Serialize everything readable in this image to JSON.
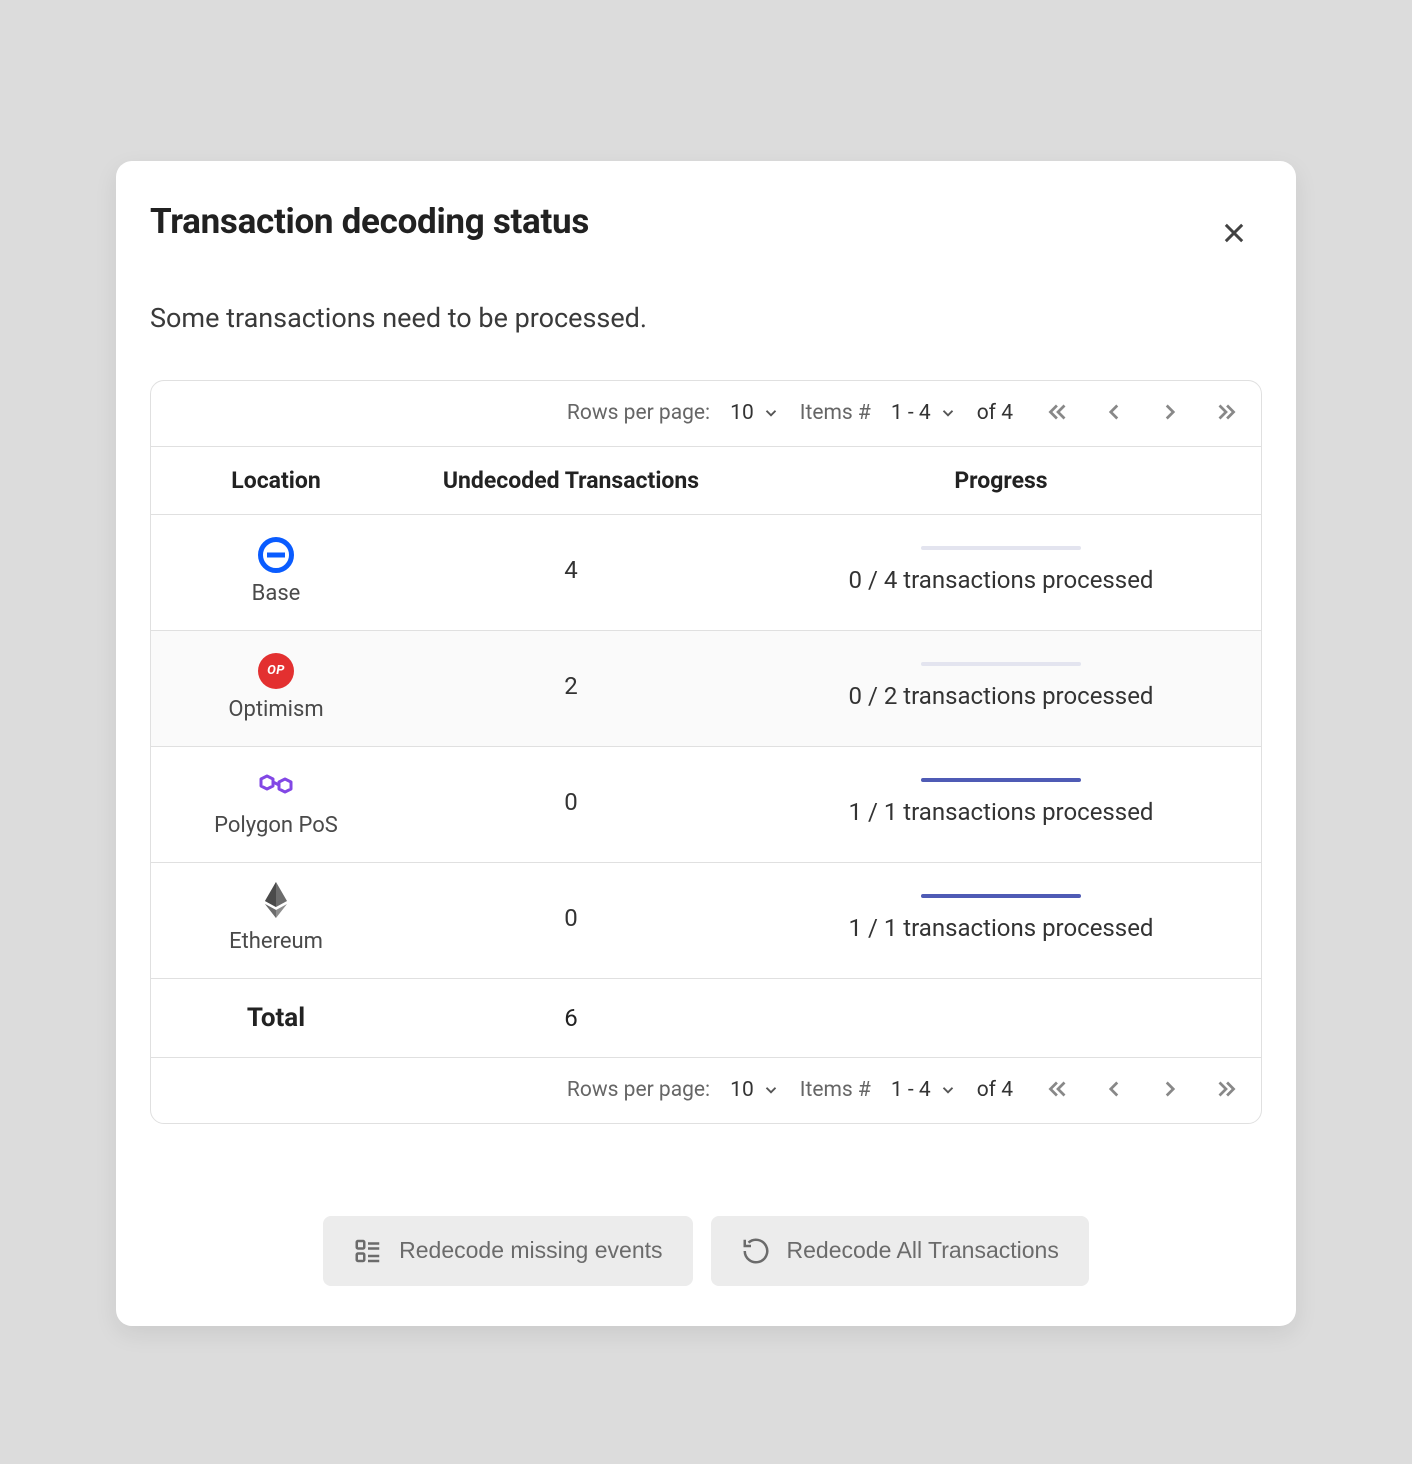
{
  "modal": {
    "title": "Transaction decoding status",
    "subtitle": "Some transactions need to be processed."
  },
  "pager": {
    "rows_label": "Rows per page:",
    "rows_value": "10",
    "items_label": "Items #",
    "range": "1 - 4",
    "of_text": "of 4"
  },
  "table": {
    "headers": {
      "location": "Location",
      "undecoded": "Undecoded Transactions",
      "progress": "Progress"
    },
    "rows": [
      {
        "name": "Base",
        "icon": "base",
        "undecoded": "4",
        "processed": 0,
        "total": 4,
        "text": "0 / 4 transactions processed"
      },
      {
        "name": "Optimism",
        "icon": "op",
        "undecoded": "2",
        "processed": 0,
        "total": 2,
        "text": "0 / 2 transactions processed"
      },
      {
        "name": "Polygon PoS",
        "icon": "polygon",
        "undecoded": "0",
        "processed": 1,
        "total": 1,
        "text": "1 / 1 transactions processed"
      },
      {
        "name": "Ethereum",
        "icon": "ethereum",
        "undecoded": "0",
        "processed": 1,
        "total": 1,
        "text": "1 / 1 transactions processed"
      }
    ],
    "total_label": "Total",
    "total_value": "6"
  },
  "buttons": {
    "redecode_missing": "Redecode missing events",
    "redecode_all": "Redecode All Transactions"
  }
}
